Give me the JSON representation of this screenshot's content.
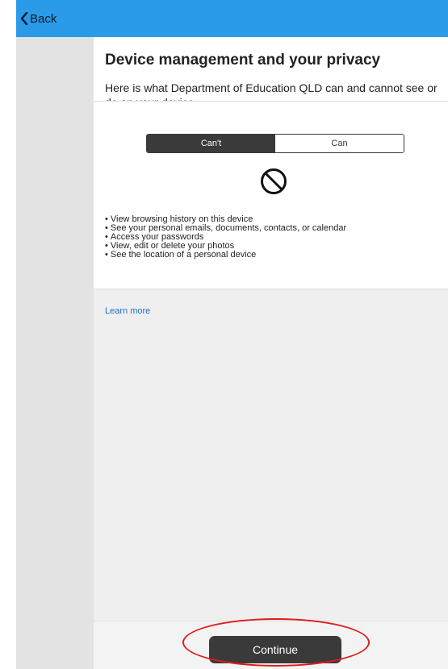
{
  "nav": {
    "back_label": "Back",
    "bar_color": "#2a9be8"
  },
  "header": {
    "title": "Device management and your privacy",
    "subtitle": "Here is what Department of Education QLD can and cannot see or do on your device."
  },
  "toggle": {
    "options": [
      "Can't",
      "Can"
    ],
    "selected": "Can't"
  },
  "cant_section": {
    "icon": "prohibited-icon",
    "items": [
      "View browsing history on this device",
      "See your personal emails, documents, contacts, or calendar",
      "Access your passwords",
      "View, edit or delete your photos",
      "See the location of a personal device"
    ]
  },
  "links": {
    "learn_more": "Learn more"
  },
  "footer": {
    "continue_label": "Continue",
    "highlight_color": "#e21b1b"
  }
}
